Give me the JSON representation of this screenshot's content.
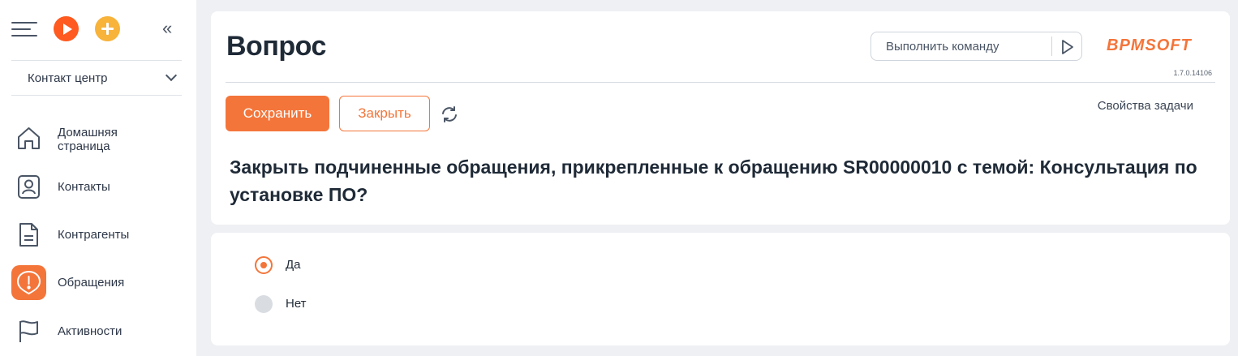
{
  "sidebar": {
    "workplace": "Контакт центр",
    "items": [
      {
        "label": "Домашняя страница",
        "icon": "home-icon",
        "active": false
      },
      {
        "label": "Контакты",
        "icon": "contact-icon",
        "active": false
      },
      {
        "label": "Контрагенты",
        "icon": "document-icon",
        "active": false
      },
      {
        "label": "Обращения",
        "icon": "case-alert-icon",
        "active": true
      },
      {
        "label": "Активности",
        "icon": "flag-icon",
        "active": false
      }
    ]
  },
  "header": {
    "title": "Вопрос",
    "command_placeholder": "Выполнить команду",
    "logo": "BPMSOFT",
    "version": "1.7.0.14106"
  },
  "toolbar": {
    "save_label": "Сохранить",
    "close_label": "Закрыть",
    "task_properties_label": "Свойства задачи"
  },
  "question": "Закрыть подчиненные обращения, прикрепленные к обращению SR00000010 с темой: Консультация по установке ПО?",
  "options": [
    {
      "label": "Да",
      "selected": true
    },
    {
      "label": "Нет",
      "selected": false
    }
  ],
  "colors": {
    "accent": "#f4753a",
    "run": "#ff5a1f",
    "add": "#f7b33a"
  }
}
